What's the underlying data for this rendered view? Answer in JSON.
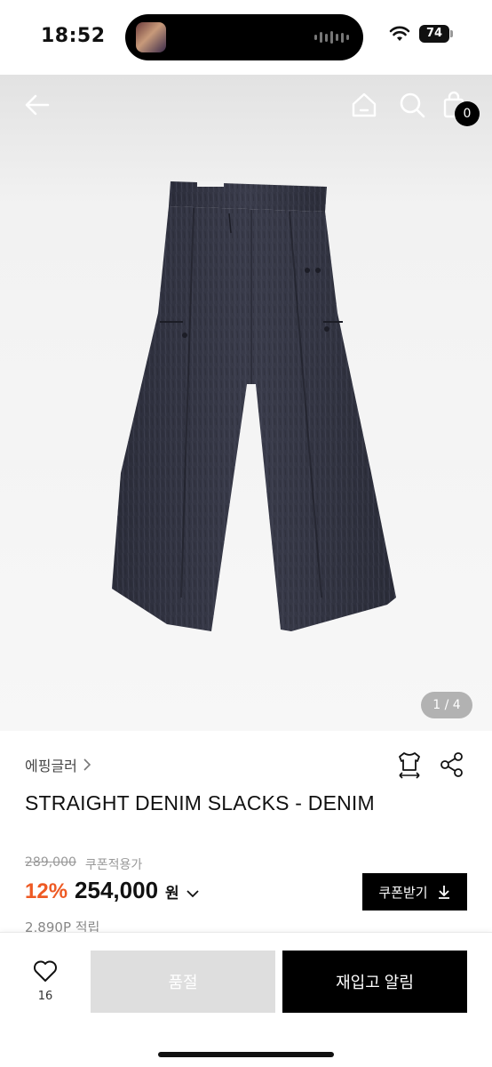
{
  "status_bar": {
    "time": "18:52",
    "battery": "74"
  },
  "gallery": {
    "cart_count": "0",
    "page_indicator": "1 / 4",
    "product_image": "wide-leg dark denim trousers"
  },
  "product": {
    "brand": "에핑글러",
    "title": "STRAIGHT DENIM SLACKS - DENIM",
    "original_price": "289,000",
    "coupon_applied_label": "쿠폰적용가",
    "discount": "12%",
    "sale_price": "254,000",
    "currency": "원",
    "coupon_button": "쿠폰받기",
    "points": "2,890P 적립"
  },
  "bottom_bar": {
    "like_count": "16",
    "soldout_label": "품절",
    "restock_label": "재입고 알림"
  },
  "icons": {
    "back": "arrow-left-icon",
    "home": "home-icon",
    "search": "search-icon",
    "cart": "shopping-bag-icon",
    "size": "size-guide-icon",
    "share": "share-icon",
    "like": "heart-icon",
    "download": "download-icon"
  },
  "colors": {
    "discount": "#ee5a24",
    "primary_button": "#000000",
    "disabled_button": "#dedede"
  }
}
